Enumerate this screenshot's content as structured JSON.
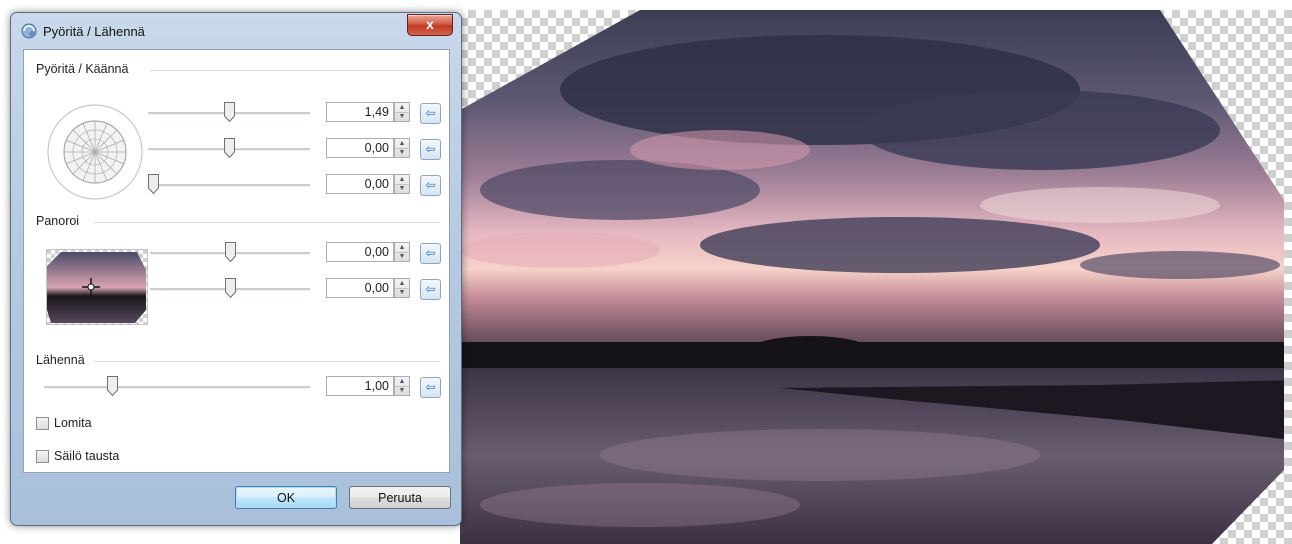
{
  "dialog": {
    "title": "Pyöritä / Lähennä",
    "close_symbol": "x",
    "rotate_section": {
      "label": "Pyöritä / Käännä",
      "sliders": [
        {
          "value": "1,49",
          "level": 0.5
        },
        {
          "value": "0,00",
          "level": 0.5
        },
        {
          "value": "0,00",
          "level": 0.0
        }
      ]
    },
    "pan_section": {
      "label": "Panoroi",
      "sliders": [
        {
          "value": "0,00",
          "level": 0.5
        },
        {
          "value": "0,00",
          "level": 0.5
        }
      ]
    },
    "zoom_section": {
      "label": "Lähennä",
      "slider": {
        "value": "1,00",
        "level": 0.25
      }
    },
    "checkboxes": [
      {
        "label": "Lomita",
        "checked": false
      },
      {
        "label": "Säilö tausta",
        "checked": false
      }
    ],
    "buttons": {
      "ok": "OK",
      "cancel": "Peruuta"
    }
  },
  "icons": {
    "title": "rotate-zoom-icon",
    "reset": "reset-arrow-icon",
    "spin_up": "▲",
    "spin_down": "▼",
    "reset_glyph": "⇦"
  },
  "colors": {
    "accent": "#3c7fb1",
    "sky": "#5a5570",
    "water": "#4a4358"
  }
}
